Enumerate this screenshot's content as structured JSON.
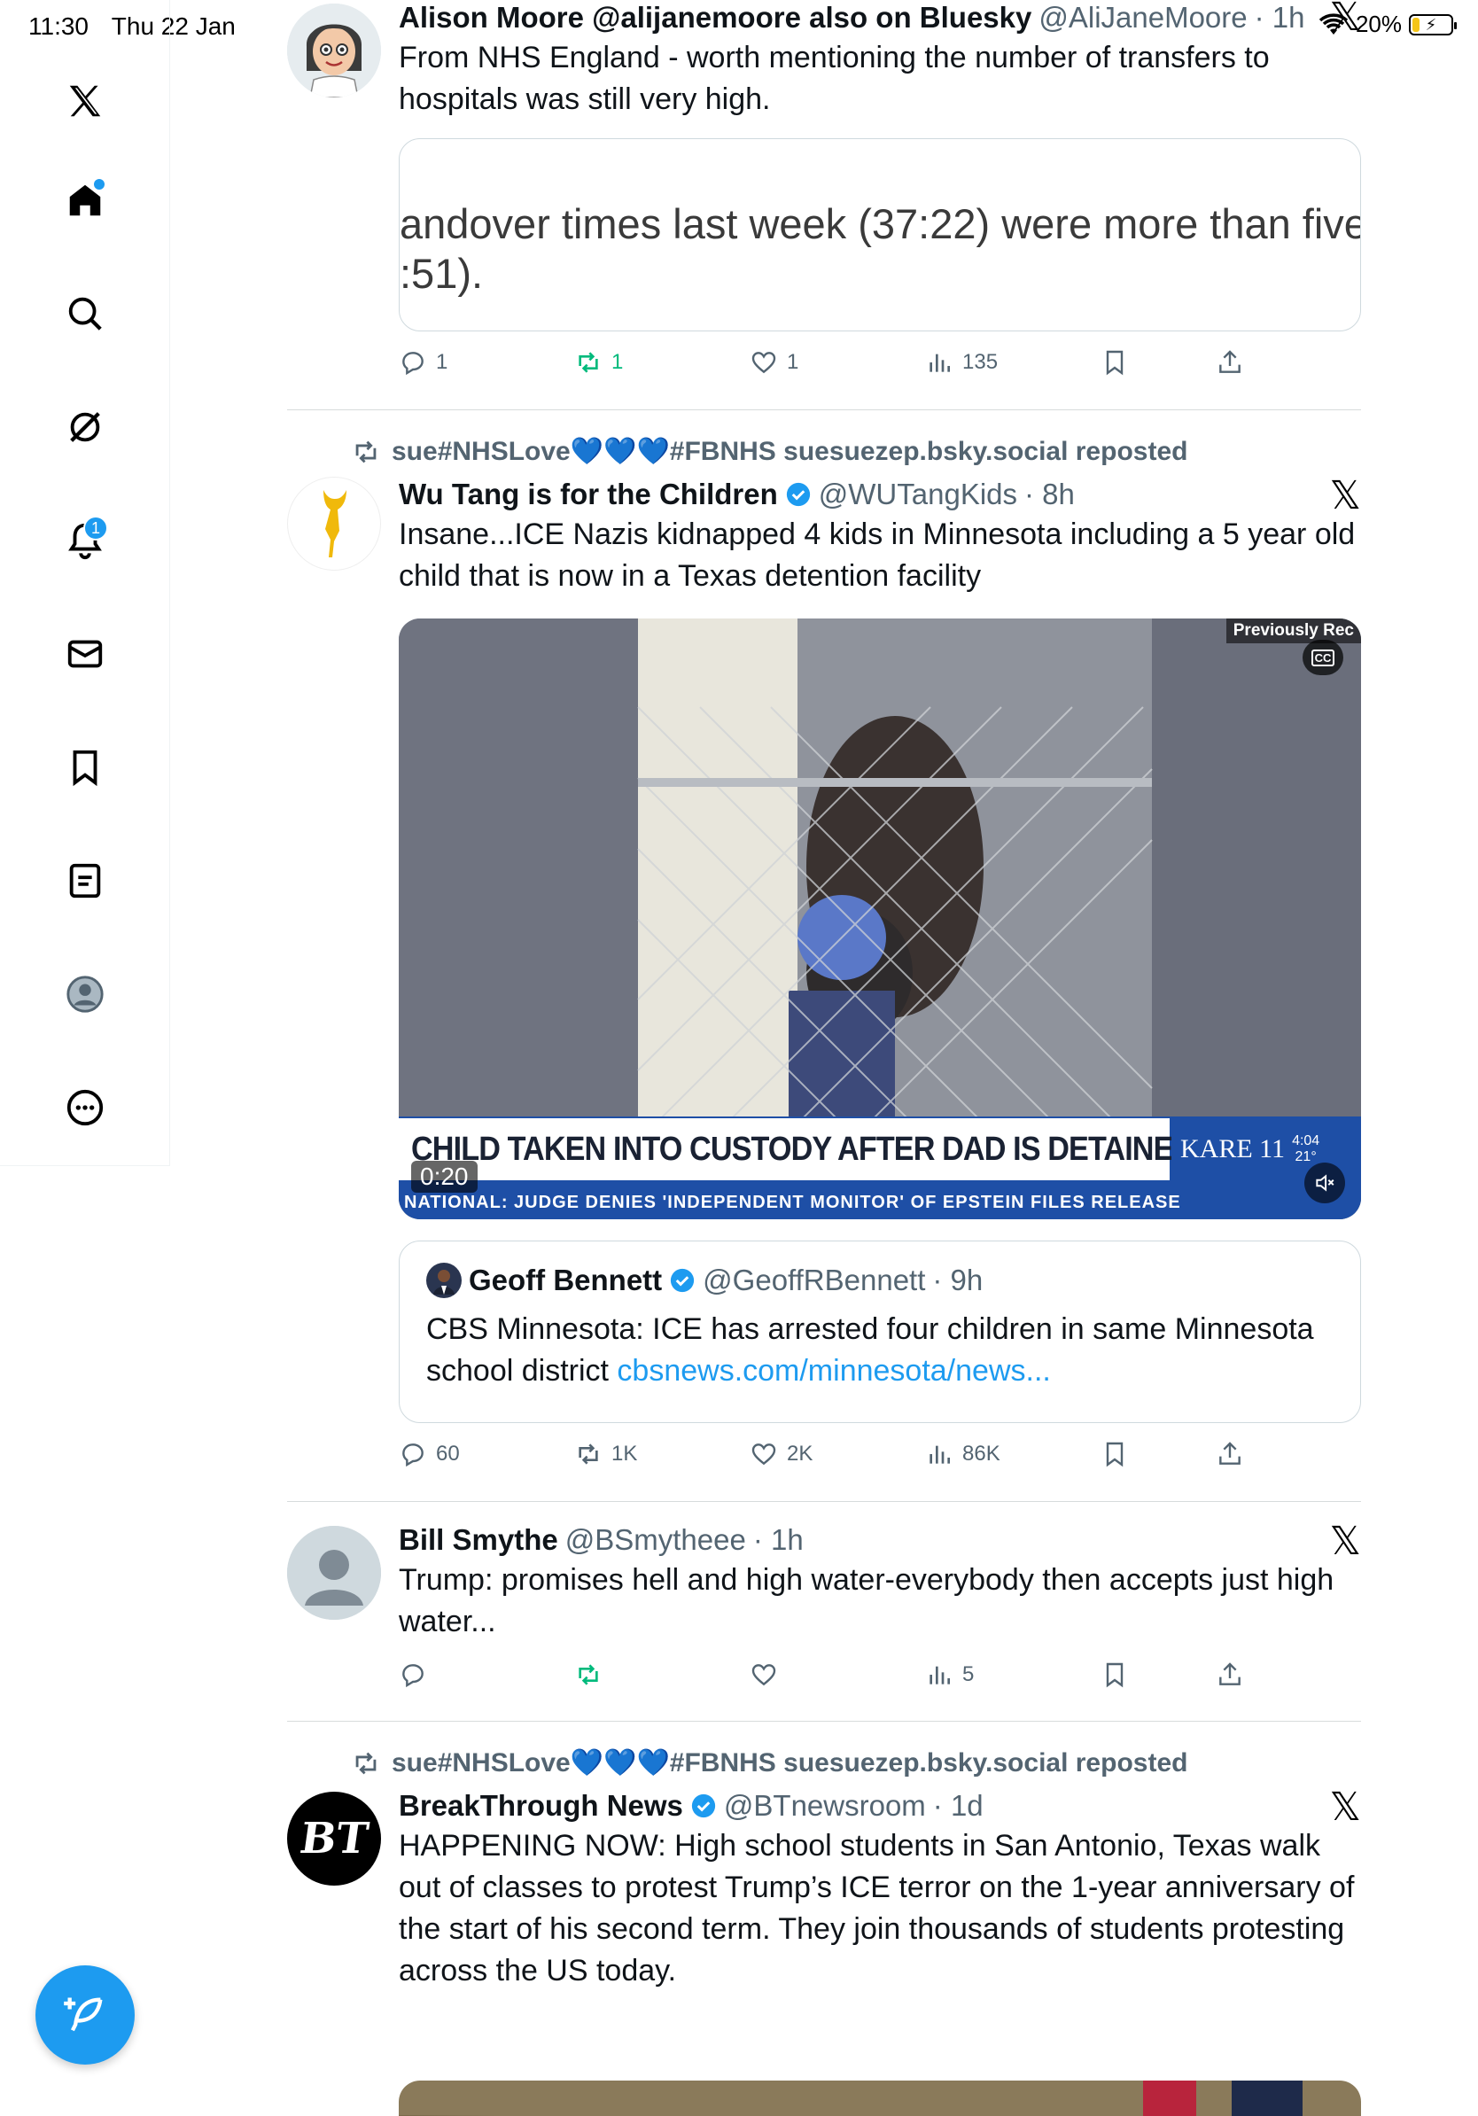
{
  "status_bar": {
    "time": "11:30",
    "date": "Thu 22 Jan",
    "battery": "20%",
    "battery_level": 0.2
  },
  "sidebar": {
    "notifications_badge": "1",
    "items": [
      "x-logo",
      "home",
      "search",
      "grok",
      "notifications",
      "messages",
      "bookmarks",
      "lists",
      "profile",
      "more"
    ]
  },
  "tweets": [
    {
      "name": "Alison Moore @alijanemoore also on Bluesky",
      "handle": "@AliJaneMoore",
      "time": "· 1h",
      "text": "From NHS England - worth mentioning the number of transfers to hospitals was still very high.",
      "image_text_line1": "andover times last week (37:22) were more than five",
      "image_text_line2": ":51).",
      "replies": "1",
      "reposts": "1",
      "likes": "1",
      "views": "135"
    },
    {
      "repost_by": "sue#NHSLove💙💙💙#FBNHS suesuezep.bsky.social reposted",
      "name": "Wu Tang is for the Children",
      "handle": "@WUTangKids",
      "time": "· 8h",
      "text": "Insane...ICE Nazis kidnapped 4 kids in Minnesota including a 5 year old child that is now in a Texas detention facility",
      "video": {
        "headline": "CHILD TAKEN INTO CUSTODY AFTER DAD IS DETAINED",
        "ticker": "NATIONAL:   JUDGE DENIES 'INDEPENDENT MONITOR' OF EPSTEIN FILES RELEASE",
        "duration": "0:20",
        "corner_label": "Previously Rec",
        "cc": "CC",
        "station": "KARE 11",
        "station_time": "4:04",
        "station_temp": "21°"
      },
      "quote": {
        "name": "Geoff Bennett",
        "handle": "@GeoffRBennett",
        "time": "· 9h",
        "text": "CBS Minnesota: ICE has arrested four children in same Minnesota school district ",
        "link": "cbsnews.com/minnesota/news..."
      },
      "replies": "60",
      "reposts": "1K",
      "likes": "2K",
      "views": "86K"
    },
    {
      "name": "Bill Smythe",
      "handle": "@BSmytheee",
      "time": "· 1h",
      "text": "Trump: promises hell and high water-everybody then accepts just high water...",
      "views": "5"
    },
    {
      "repost_by": "sue#NHSLove💙💙💙#FBNHS suesuezep.bsky.social reposted",
      "name": "BreakThrough News",
      "handle": "@BTnewsroom",
      "time": "· 1d",
      "text": "HAPPENING NOW: High school students in San Antonio, Texas walk out of classes to protest Trump’s ICE terror on the 1-year anniversary of the start of his second term. They join thousands of students protesting across the US today.",
      "avatar_text": "BT"
    }
  ],
  "colors": {
    "accent": "#1d9bf0",
    "repost_green": "#00ba7c",
    "secondary_text": "#536471"
  }
}
